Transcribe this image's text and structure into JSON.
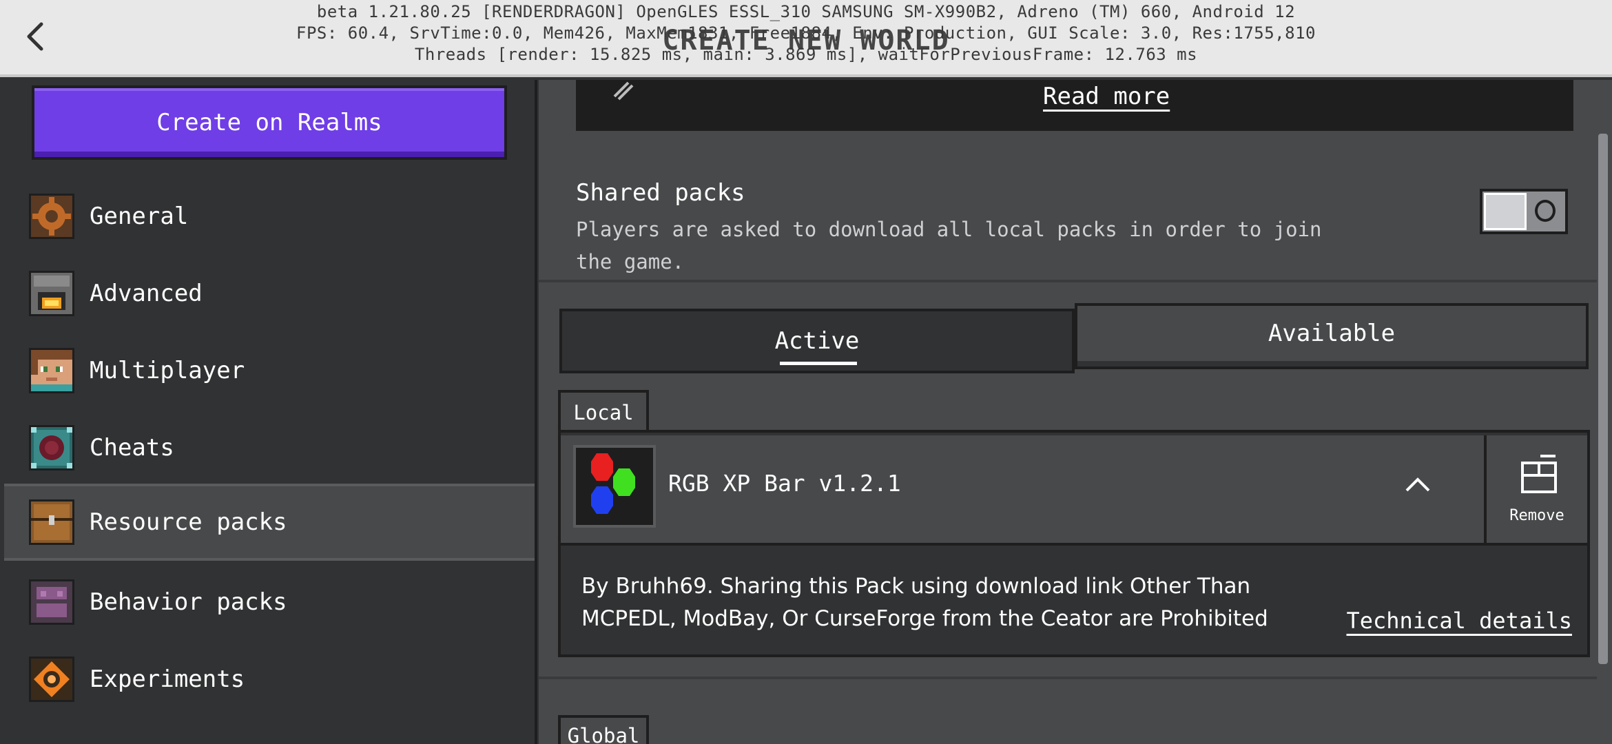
{
  "header": {
    "title": "CREATE NEW WORLD",
    "debug_lines": [
      "beta 1.21.80.25 [RENDERDRAGON] OpenGLES ESSL_310 SAMSUNG SM-X990B2, Adreno (TM) 660, Android 12",
      "FPS: 60.4, SrvTime:0.0, Mem426, MaxMem1831, Free1884, Env: Production, GUI Scale: 3.0, Res:1755,810",
      "Threads [render: 15.825 ms, main: 3.869 ms], waitForPreviousFrame: 12.763 ms"
    ]
  },
  "sidebar": {
    "realms_button": "Create on Realms",
    "items": [
      {
        "label": "General",
        "icon": "gear-icon"
      },
      {
        "label": "Advanced",
        "icon": "furnace-icon"
      },
      {
        "label": "Multiplayer",
        "icon": "player-head-icon"
      },
      {
        "label": "Cheats",
        "icon": "command-block-icon"
      },
      {
        "label": "Resource packs",
        "icon": "chest-icon",
        "selected": true
      },
      {
        "label": "Behavior packs",
        "icon": "behavior-icon"
      },
      {
        "label": "Experiments",
        "icon": "experiment-icon"
      }
    ]
  },
  "main": {
    "read_more": "Read more",
    "shared_packs": {
      "title": "Shared packs",
      "description": "Players are asked to download all local packs in order to join the game.",
      "enabled": false
    },
    "tabs": [
      {
        "label": "Active",
        "selected": true
      },
      {
        "label": "Available",
        "selected": false
      }
    ],
    "local_label": "Local",
    "pack": {
      "name": "RGB XP Bar v1.2.1",
      "remove_label": "Remove",
      "description": "By Bruhh69. Sharing this Pack using download link Other Than MCPEDL, ModBay, Or CurseForge from the Ceator are Prohibited",
      "technical_details": "Technical details"
    },
    "global_label": "Global"
  },
  "colors": {
    "realms_purple": "#6f3ee6",
    "panel_dark": "#313233",
    "panel_mid": "#48494a",
    "border": "#1e1e1f"
  }
}
